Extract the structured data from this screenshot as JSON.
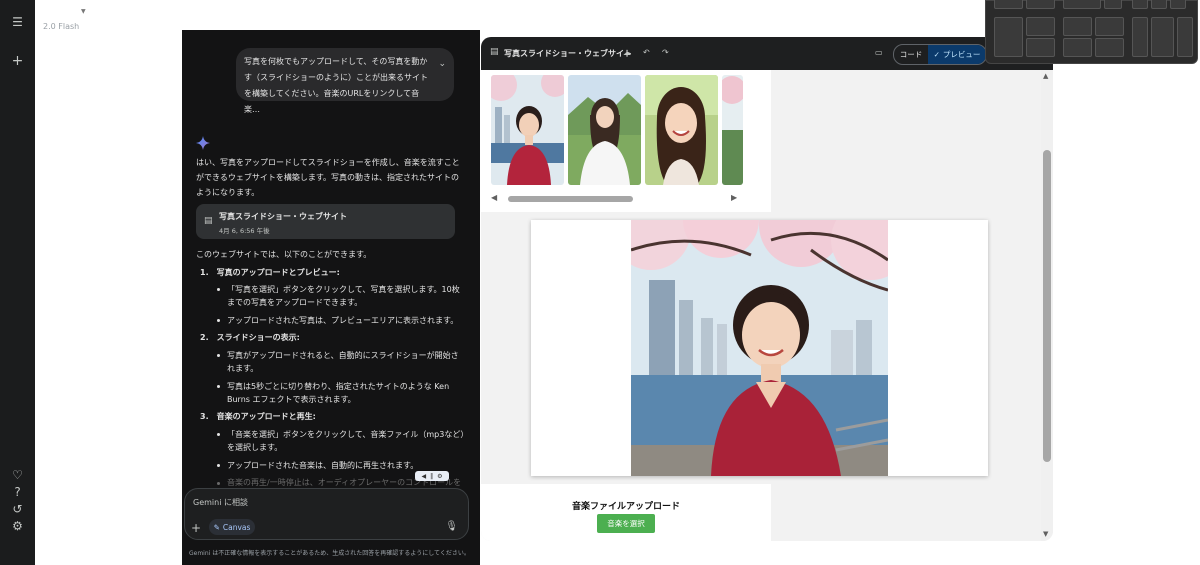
{
  "header": {
    "model_label": "2.0 Flash"
  },
  "chat": {
    "user_prompt": [
      "写真を何枚でもアップロードして、その写真を動か",
      "す（スライドショーのように）ことが出来るサイト",
      "を構築してください。音楽のURLをリンクして音楽…"
    ],
    "reply_intro": [
      "はい、写真をアップロードしてスライドショーを作成し、音楽を流すこと",
      "ができるウェブサイトを構築します。写真の動きは、指定されたサイトの",
      "ようになります。"
    ],
    "card": {
      "title": "写真スライドショー・ウェブサイト",
      "time": "4月 6, 6:56 午後"
    },
    "lead": "このウェブサイトでは、以下のことができます。",
    "sections": [
      {
        "heading": "1.　写真のアップロードとプレビュー:",
        "bullets": [
          [
            "「写真を選択」ボタンをクリックして、写真を選択します。10枚",
            "までの写真をアップロードできます。"
          ],
          [
            "アップロードされた写真は、プレビューエリアに表示されます。"
          ]
        ]
      },
      {
        "heading": "2.　スライドショーの表示:",
        "bullets": [
          [
            "写真がアップロードされると、自動的にスライドショーが開始さ",
            "れます。"
          ],
          [
            "写真は5秒ごとに切り替わり、指定されたサイトのような Ken",
            "Burns エフェクトで表示されます。"
          ]
        ]
      },
      {
        "heading": "3.　音楽のアップロードと再生:",
        "bullets": [
          [
            "「音楽を選択」ボタンをクリックして、音楽ファイル（mp3など）",
            "を選択します。"
          ],
          [
            "アップロードされた音楽は、自動的に再生されます。"
          ]
        ]
      }
    ],
    "faded_line": "音楽の再生/一時停止は、オーディオプレーヤーのコントロールを"
  },
  "input": {
    "placeholder": "Gemini に相談",
    "canvas_label": "Canvas"
  },
  "disclaimer": "Gemini は不正確な情報を表示することがあるため、生成された回答を再確認するようにしてください。",
  "panel": {
    "title": "写真スライドショー・ウェブサイト",
    "tab_code": "コード",
    "tab_preview": "プレビュー",
    "music_heading": "音楽ファイルアップロード",
    "music_button": "音楽を選択"
  },
  "colors": {
    "app_bg": "#131314",
    "accent_blue": "#a8c7fa",
    "button_green": "#4caf50"
  }
}
